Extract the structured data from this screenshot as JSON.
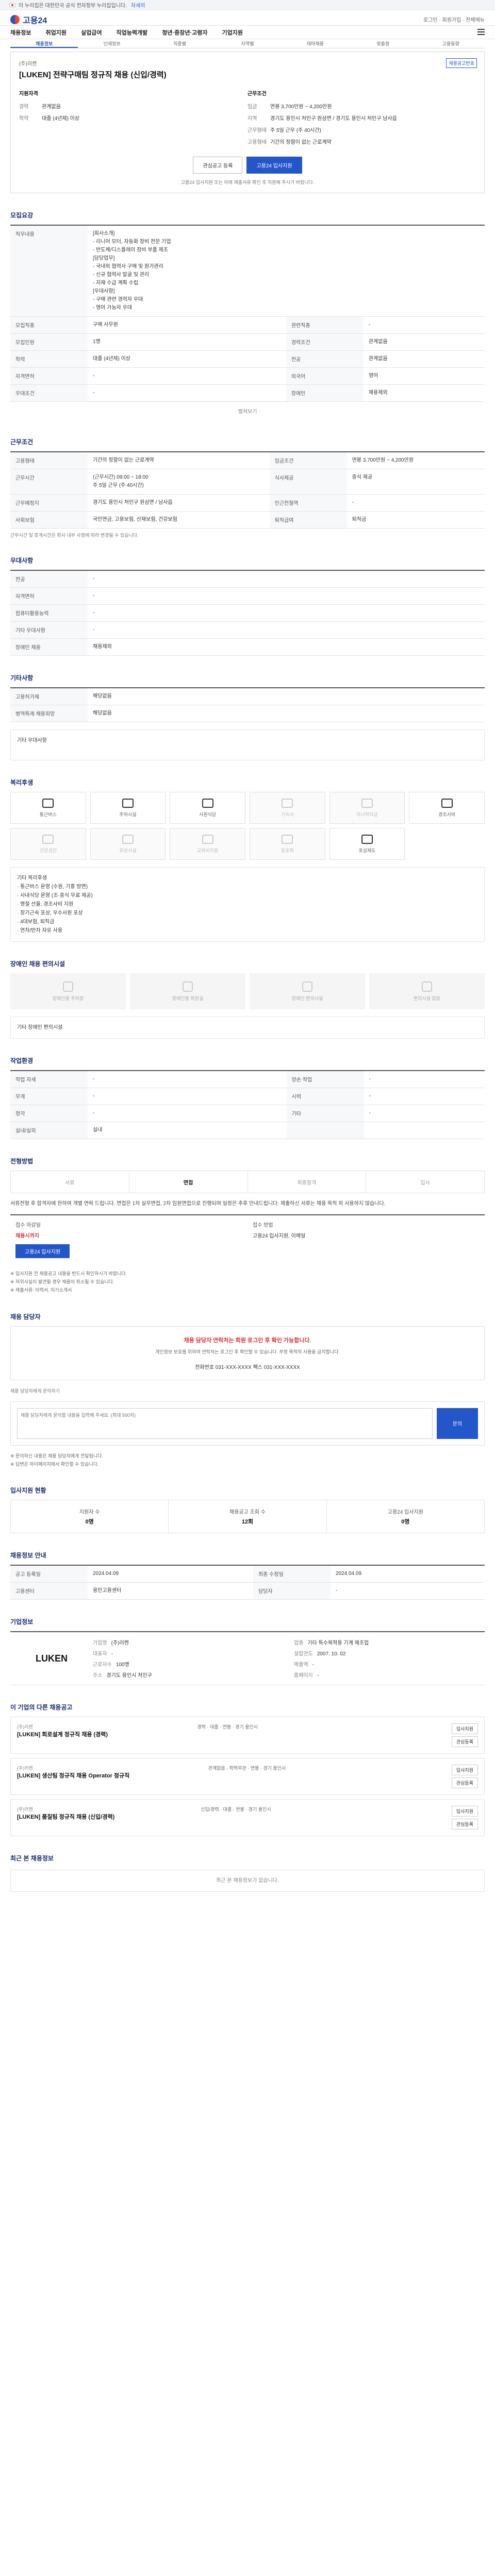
{
  "topbar": {
    "text": "이 누리집은 대한민국 공식 전자정부 누리집입니다.",
    "more": "자세히"
  },
  "site": {
    "logo": "고용24",
    "top_links": "로그인 · 회원가입 · 전체메뉴"
  },
  "gnb": [
    "채용정보",
    "취업지원",
    "실업급여",
    "직업능력개발",
    "청년·중장년·고령자",
    "기업지원"
  ],
  "tabs": [
    "채용정보",
    "인재정보",
    "직종별",
    "지역별",
    "테마채용",
    "맞춤형",
    "고용동향"
  ],
  "job": {
    "company": "(주)러켄",
    "title": "[LUKEN] 전략구매팀 정규직 채용 (신입/경력)",
    "badge": "채용공고번호",
    "qual_title": "지원자격",
    "cond_title": "근무조건",
    "qual": [
      {
        "k": "경력",
        "v": "관계없음"
      },
      {
        "k": "학력",
        "v": "대졸 (4년제) 이상"
      }
    ],
    "cond": [
      {
        "k": "임금",
        "v": "연봉 3,700만원 ~ 4,200만원"
      },
      {
        "k": "지역",
        "v": "경기도 용인시 처인구 원삼면 / 경기도 용인시 처인구 남사읍"
      },
      {
        "k": "근무형태",
        "v": "주 5일 근무 (주 40시간)"
      },
      {
        "k": "고용형태",
        "v": "기간의 정함이 없는 근로계약"
      }
    ],
    "btn_scrap": "관심공고 등록",
    "btn_apply": "고용24 입사지원",
    "notice": "고용24 입사지원 또는 아래 제출서류 확인 후 지원해 주시기 바랍니다."
  },
  "recruit": {
    "title": "모집요강",
    "duty_k": "직무내용",
    "duty": "[회사소개]\n- 리니어 모터, 자동화 장비 전문 기업\n- 반도체/디스플레이 장비 부품 제조\n[담당업무]\n- 국내외 협력사 구매 및 원가관리\n- 신규 협력사 발굴 및 관리\n- 자재 수급 계획 수립\n[우대사항]\n- 구매 관련 경력자 우대\n- 영어 가능자 우대",
    "rows": [
      [
        "모집직종",
        "구매 사무원",
        "관련직종",
        "-"
      ],
      [
        "모집인원",
        "1명",
        "경력조건",
        "관계없음"
      ],
      [
        "학력",
        "대졸 (4년제) 이상",
        "전공",
        "관계없음"
      ],
      [
        "자격면허",
        "-",
        "외국어",
        "영어"
      ],
      [
        "우대조건",
        "-",
        "장애인",
        "채용제외"
      ]
    ],
    "more": "펼쳐보기"
  },
  "work": {
    "title": "근무조건",
    "rows": [
      [
        "고용형태",
        "기간의 정함이 없는 근로계약",
        "임금조건",
        "연봉 3,700만원 ~ 4,200만원"
      ],
      [
        "근무시간",
        "(근무시간) 09:00 ~ 18:00\n주 5일 근무 (주 40시간)",
        "식사제공",
        "중식 제공"
      ],
      [
        "근무예정지",
        "경기도 용인시 처인구 원삼면 / 남사읍",
        "인근전철역",
        "-"
      ],
      [
        "사회보험",
        "국민연금, 고용보험, 산재보험, 건강보험",
        "퇴직급여",
        "퇴직금"
      ]
    ],
    "note": "근무시간 및 휴게시간은 회사 내부 사정에 따라 변경될 수 있습니다."
  },
  "docs": {
    "title": "우대사항",
    "rows": [
      [
        "전공",
        "-"
      ],
      [
        "자격면허",
        "-"
      ],
      [
        "컴퓨터활용능력",
        "-"
      ],
      [
        "기타 우대사항",
        "-"
      ],
      [
        "장애인 채용",
        "채용제외"
      ]
    ]
  },
  "etc": {
    "title": "기타사항",
    "rows": [
      [
        "고용허가제",
        "해당없음"
      ],
      [
        "병역특례 채용희망",
        "해당없음"
      ]
    ],
    "box": "기타 우대사항"
  },
  "welfare": {
    "title": "복리후생",
    "items": [
      {
        "l": "통근버스",
        "on": true
      },
      {
        "l": "주차시설",
        "on": true
      },
      {
        "l": "사원식당",
        "on": true
      },
      {
        "l": "기숙사",
        "on": false
      },
      {
        "l": "자녀학자금",
        "on": false
      },
      {
        "l": "경조사비",
        "on": true
      },
      {
        "l": "건강검진",
        "on": false
      },
      {
        "l": "휴양시설",
        "on": false
      },
      {
        "l": "교육비지원",
        "on": false
      },
      {
        "l": "동호회",
        "on": false
      },
      {
        "l": "포상제도",
        "on": true
      }
    ],
    "box": "기타 복리후생\n· 통근버스 운영 (수원, 기흥 방면)\n· 사내식당 운영 (조·중식 무료 제공)\n· 명절 선물, 경조사비 지원\n· 장기근속 포상, 우수사원 포상\n· 4대보험, 퇴직금\n· 연차/반차 자유 사용"
  },
  "disability": {
    "title": "장애인 채용 편의시설",
    "items": [
      "장애인용 주차장",
      "장애인용 화장실",
      "장애인 편의시설",
      "편의시설 없음"
    ],
    "note": "기타 장애인 편의시설",
    "rows": [
      [
        "작업환경",
        "-"
      ]
    ]
  },
  "workenv": {
    "title": "작업환경",
    "rows": [
      [
        "작업 자세",
        "-",
        "양손 작업",
        "-"
      ],
      [
        "무게",
        "-",
        "시력",
        "-"
      ],
      [
        "청각",
        "-",
        "기타",
        "-"
      ],
      [
        "실내/실외",
        "실내",
        "",
        ""
      ]
    ]
  },
  "process": {
    "title": "전형방법",
    "steps": [
      "서류",
      "면접",
      "최종합격",
      "입사"
    ],
    "para": "서류전형 후 합격자에 한하여 개별 연락 드립니다. 면접은 1차 실무면접, 2차 임원면접으로 진행되며 일정은 추후 안내드립니다. 제출하신 서류는 채용 목적 외 사용하지 않습니다.",
    "deadline_t": "접수 마감일",
    "deadline": "채용시까지",
    "method_t": "접수 방법",
    "method": "고용24 입사지원, 이메일",
    "apply": "고용24 입사지원",
    "bullets": "※ 입사지원 전 채용공고 내용을 반드시 확인하시기 바랍니다.\n※ 허위사실이 발견될 경우 채용이 취소될 수 있습니다.\n※ 제출서류: 이력서, 자기소개서"
  },
  "contact": {
    "title": "채용 담당자",
    "warn": "채용 담당자 연락처는 회원 로그인 후 확인 가능합니다.",
    "desc": "개인정보 보호를 위하여 연락처는 로그인 후 확인할 수 있습니다. 부정 목적의 사용을 금지합니다.",
    "phone": "전화번호 031-XXX-XXXX   팩스 031-XXX-XXXX",
    "inq_title": "채용 담당자에게 문의하기",
    "inq_ph": "채용 담당자에게 문의할 내용을 입력해 주세요. (최대 500자)",
    "send": "문의",
    "bullets": "※ 문의하신 내용은 채용 담당자에게 전달됩니다.\n※ 답변은 마이페이지에서 확인할 수 있습니다."
  },
  "stats": {
    "title": "입사지원 현황",
    "items": [
      {
        "k": "지원자 수",
        "v": "0명"
      },
      {
        "k": "채용공고 조회 수",
        "v": "12회"
      },
      {
        "k": "고용24 입사지원",
        "v": "0명"
      }
    ]
  },
  "info": {
    "title": "채용정보 안내",
    "rows": [
      [
        "공고 등록일",
        "2024.04.09",
        "최종 수정일",
        "2024.04.09"
      ],
      [
        "고용센터",
        "용인고용센터",
        "담당자",
        "-"
      ]
    ]
  },
  "corp": {
    "title": "기업정보",
    "logo": "LUKEN",
    "rows": [
      [
        "기업명",
        "(주)러켄"
      ],
      [
        "업종",
        "기타 특수목적용 기계 제조업"
      ],
      [
        "대표자",
        "-"
      ],
      [
        "설립연도",
        "2007. 10. 02"
      ],
      [
        "근로자수",
        "100명"
      ],
      [
        "매출액",
        "-"
      ],
      [
        "주소",
        "경기도 용인시 처인구"
      ],
      [
        "홈페이지",
        "-"
      ]
    ]
  },
  "related": {
    "title": "이 기업의 다른 채용공고",
    "items": [
      {
        "c": "(주)러켄",
        "t": "[LUKEN] 회로설계 정규직 채용 (경력)",
        "meta": "경력 · 대졸 · 연봉 · 경기 용인시"
      },
      {
        "c": "(주)러켄",
        "t": "[LUKEN] 생산팀 정규직 채용 Operator 정규직",
        "meta": "관계없음 · 학력무관 · 연봉 · 경기 용인시"
      },
      {
        "c": "(주)러켄",
        "t": "[LUKEN] 품질팀 정규직 채용 (신입/경력)",
        "meta": "신입/경력 · 대졸 · 연봉 · 경기 용인시"
      }
    ],
    "btn1": "입사지원",
    "btn2": "관심등록"
  },
  "recent": {
    "title": "최근 본 채용정보",
    "empty": "최근 본 채용정보가 없습니다."
  }
}
